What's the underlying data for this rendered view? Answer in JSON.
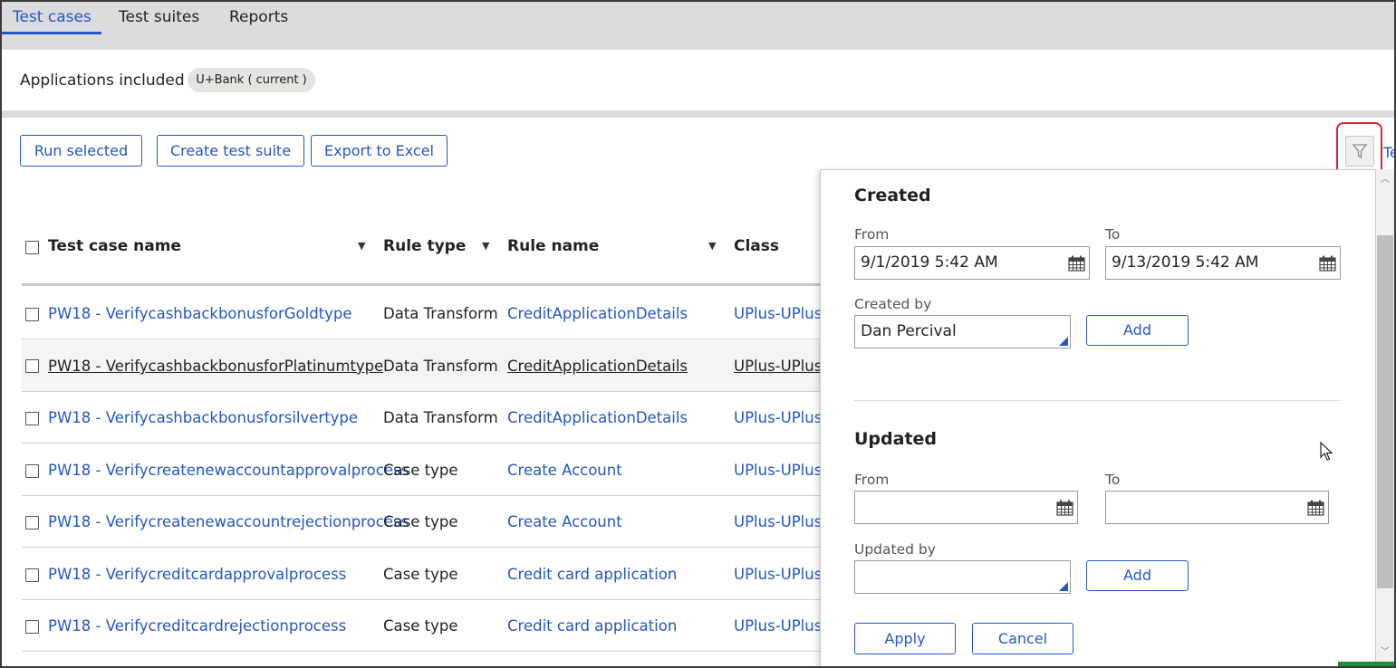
{
  "tabs": [
    {
      "label": "Test cases",
      "active": true
    },
    {
      "label": "Test suites",
      "active": false
    },
    {
      "label": "Reports",
      "active": false
    }
  ],
  "applications": {
    "label": "Applications included :",
    "pill": "U+Bank ( current )"
  },
  "toolbar": {
    "run_selected": "Run selected",
    "create_suite": "Create test suite",
    "export_excel": "Export to Excel",
    "truncated_link": "Te"
  },
  "table": {
    "headers": [
      "Test case name",
      "Rule type",
      "Rule name",
      "Class"
    ],
    "rows": [
      {
        "name": "PW18 - VerifycashbackbonusforGoldtype",
        "rule_type": "Data Transform",
        "rule_name": "CreditApplicationDetails",
        "class": "UPlus-UPlus_"
      },
      {
        "name": "PW18 - VerifycashbackbonusforPlatinumtype",
        "rule_type": "Data Transform",
        "rule_name": "CreditApplicationDetails",
        "class": "UPlus-UPlus_"
      },
      {
        "name": "PW18 - Verifycashbackbonusforsilvertype",
        "rule_type": "Data Transform",
        "rule_name": "CreditApplicationDetails",
        "class": "UPlus-UPlus_"
      },
      {
        "name": "PW18 - Verifycreatenewaccountapprovalprocess",
        "rule_type": "Case type",
        "rule_name": "Create Account",
        "class": "UPlus-UPlus_"
      },
      {
        "name": "PW18 - Verifycreatenewaccountrejectionprocess",
        "rule_type": "Case type",
        "rule_name": "Create Account",
        "class": "UPlus-UPlus_"
      },
      {
        "name": "PW18 - Verifycreditcardapprovalprocess",
        "rule_type": "Case type",
        "rule_name": "Credit card application",
        "class": "UPlus-UPlus_"
      },
      {
        "name": "PW18 - Verifycreditcardrejectionprocess",
        "rule_type": "Case type",
        "rule_name": "Credit card application",
        "class": "UPlus-UPlus_"
      }
    ]
  },
  "filter": {
    "created": {
      "title": "Created",
      "from_label": "From",
      "from_value": "9/1/2019 5:42 AM",
      "to_label": "To",
      "to_value": "9/13/2019 5:42 AM",
      "by_label": "Created by",
      "by_value": "Dan Percival",
      "add": "Add"
    },
    "updated": {
      "title": "Updated",
      "from_label": "From",
      "from_value": "",
      "to_label": "To",
      "to_value": "",
      "by_label": "Updated by",
      "by_value": "",
      "add": "Add"
    },
    "apply": "Apply",
    "cancel": "Cancel"
  },
  "icons": {
    "filter": "funnel-icon",
    "calendar": "calendar-icon",
    "column_filter": "funnel-small-icon"
  },
  "colors": {
    "accent": "#2456c8",
    "highlight": "#d9262c",
    "tab_bg": "#dcdcde"
  }
}
